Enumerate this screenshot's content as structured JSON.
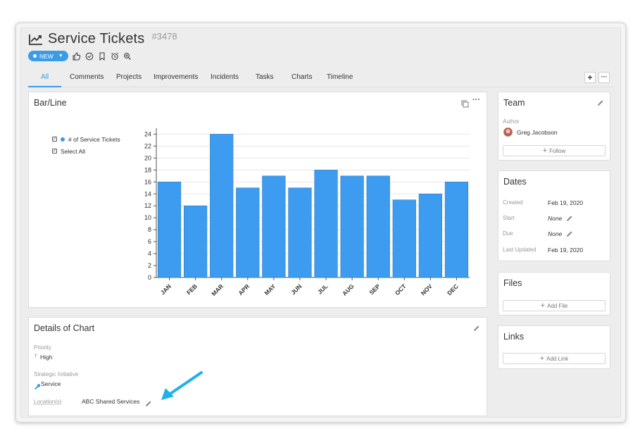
{
  "header": {
    "title": "Service Tickets",
    "ticket_id": "#3478",
    "icon": "chart-line-icon"
  },
  "status": {
    "label": "NEW",
    "color": "#3a9be8"
  },
  "actions": [
    "thumbs-up-icon",
    "check-circle-icon",
    "bookmark-icon",
    "alarm-icon",
    "zoom-icon"
  ],
  "tabs": [
    {
      "label": "All"
    },
    {
      "label": "Comments"
    },
    {
      "label": "Projects"
    },
    {
      "label": "Improvements"
    },
    {
      "label": "Incidents"
    },
    {
      "label": "Tasks"
    },
    {
      "label": "Charts"
    },
    {
      "label": "Timeline"
    }
  ],
  "toolbar": {
    "add_label": "+",
    "more_label": "···"
  },
  "chart_panel": {
    "title": "Bar/Line",
    "legend": {
      "series_label": "# of Service Tickets",
      "select_all_label": "Select All"
    }
  },
  "chart_data": {
    "type": "bar",
    "categories": [
      "JAN",
      "FEB",
      "MAR",
      "APR",
      "MAY",
      "JUN",
      "JUL",
      "AUG",
      "SEP",
      "OCT",
      "NOV",
      "DEC"
    ],
    "series": [
      {
        "name": "# of Service Tickets",
        "values": [
          16,
          12,
          24,
          15,
          17,
          15,
          18,
          17,
          17,
          13,
          14,
          16
        ],
        "color": "#3d9cf0"
      }
    ],
    "yticks": [
      0,
      2,
      4,
      6,
      8,
      10,
      12,
      14,
      16,
      18,
      20,
      22,
      24
    ],
    "ylim": [
      0,
      25
    ],
    "grid": true,
    "legend_position": "left"
  },
  "details": {
    "title": "Details of Chart",
    "priority_label": "Priority",
    "priority_value": "High",
    "initiative_label": "Strategic Initiative",
    "initiative_value": "Service",
    "location_label": "Location(s)",
    "location_value": "ABC Shared Services"
  },
  "team": {
    "title": "Team",
    "author_label": "Author",
    "author_name": "Greg Jacobson",
    "follow_label": "Follow"
  },
  "dates": {
    "title": "Dates",
    "rows": [
      {
        "label": "Created",
        "value": "Feb 19, 2020"
      },
      {
        "label": "Start",
        "value": "None"
      },
      {
        "label": "Due",
        "value": "None"
      },
      {
        "label": "Last Updated",
        "value": "Feb 19, 2020"
      }
    ]
  },
  "files": {
    "title": "Files",
    "add_label": "Add File"
  },
  "links": {
    "title": "Links",
    "add_label": "Add Link"
  },
  "annotation": {
    "arrow_color": "#1fb2e8"
  }
}
